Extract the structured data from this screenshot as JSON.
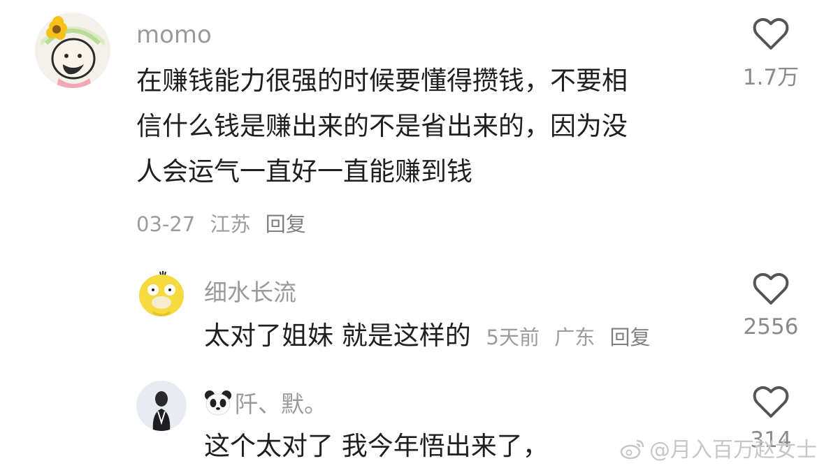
{
  "comments": [
    {
      "username": "momo",
      "text_lines": [
        "在赚钱能力很强的时候要懂得攒钱，不要相",
        "信什么钱是赚出来的不是省出来的，因为没",
        "人会运气一直好一直能赚到钱"
      ],
      "date": "03-27",
      "location": "江苏",
      "reply_label": "回复",
      "likes": "1.7万",
      "avatar_icon": "cartoon-face-sunflower-icon"
    },
    {
      "username": "细水长流",
      "text": "太对了姐妹 就是这样的",
      "date": "5天前",
      "location": "广东",
      "reply_label": "回复",
      "likes": "2556",
      "avatar_icon": "yellow-duck-icon"
    },
    {
      "username": "阡、默。",
      "text": "这个太对了 我今年悟出来了，",
      "likes": "314",
      "avatar_icon": "woman-photo-icon",
      "name_icon": "panda-icon"
    }
  ],
  "watermark": "@月入百万赵女士",
  "icons": {
    "like": "heart-outline-icon",
    "watermark_logo": "weibo-logo-icon"
  },
  "colors": {
    "text": "#1f1f1f",
    "secondary": "#9a9a9a",
    "background": "#ffffff"
  }
}
